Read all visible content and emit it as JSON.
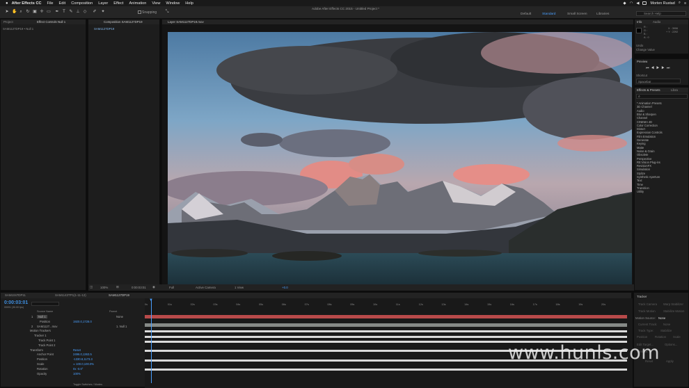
{
  "menubar": {
    "app": "After Effects CC",
    "items": [
      "File",
      "Edit",
      "Composition",
      "Layer",
      "Effect",
      "Animation",
      "View",
      "Window",
      "Help"
    ],
    "user": "Morten Rustad"
  },
  "toolbar": {
    "snapping": "Snapping",
    "window_title": "Adobe After Effects CC 2015 - Untitled Project *",
    "workspaces": [
      "Default",
      "Standard",
      "Small Screen",
      "Libraries"
    ],
    "active_workspace": "Standard",
    "search_placeholder": "Search Help"
  },
  "project_panel": {
    "tabs": [
      "Project",
      "Effect Controls Null 1"
    ],
    "breadcrumb": "SAM1127DP19 • Null 1"
  },
  "comp_panel": {
    "tab": "Composition SAM1127DP19",
    "comp_name": "SAM1127DP19",
    "layer_tab": "Layer SAM1127DP19.mov"
  },
  "viewer_bar": {
    "zoom": "100%",
    "timecode": "0:00:03:01",
    "resolution": "Full",
    "camera": "Active Camera",
    "views": "1 View",
    "offset": "+0.0"
  },
  "info_panel": {
    "tabs": [
      "Info",
      "Audio"
    ],
    "values": [
      "R :",
      "G :",
      "B :",
      "A : 0"
    ],
    "coords": [
      "X : 3996",
      "+ Y : 2292"
    ],
    "undo_label": "Undo",
    "undo_value": "Change Value"
  },
  "preview_panel": {
    "title": "Preview",
    "shortcut_label": "Shortcut",
    "shortcut_value": "Spacebar"
  },
  "effects_panel": {
    "tabs": [
      "Effects & Presets",
      "Libra"
    ],
    "items": [
      "* Animation Presets",
      "3D Channel",
      "Audio",
      "Blur & Sharpen",
      "Channel",
      "CINEMA 4D",
      "Color Correction",
      "Distort",
      "Expression Controls",
      "Film Emulation",
      "Generate",
      "Keying",
      "Matte",
      "Noise & Grain",
      "Obsolete",
      "Perspective",
      "RE:Vision Plug-ins",
      "RevisionFX",
      "Simulation",
      "Stylize",
      "Synthetic Aperture",
      "Text",
      "Time",
      "Transition",
      "Utility"
    ]
  },
  "timeline": {
    "tabs": [
      "SAM1047DP11",
      "SAM1143TP1(1-11-12)",
      "SAM1127DP19"
    ],
    "timecode": "0:00:03:01",
    "frame_info": "00091 (30.00 fps)",
    "source_name_header": "Source Name",
    "parent_header": "Parent",
    "ruler_marks": [
      "0s",
      "01s",
      "02s",
      "03s",
      "04s",
      "05s",
      "06s",
      "07s",
      "08s",
      "09s",
      "10s",
      "11s",
      "12s",
      "13s",
      "14s",
      "15s",
      "16s",
      "17s",
      "18s",
      "19s",
      "20s"
    ],
    "layers": [
      {
        "num": "1",
        "name": "Null 1",
        "parent": "None"
      },
      {
        "num": "",
        "name": "Position",
        "value": "1920.0,1728.0"
      },
      {
        "num": "2",
        "name": "SAM1127...mov",
        "parent": "1. Null 1"
      },
      {
        "num": "",
        "name": "Motion Trackers"
      },
      {
        "num": "",
        "name": "Tracker 1"
      },
      {
        "num": "",
        "name": "Track Point 1"
      },
      {
        "num": "",
        "name": "Track Point 2"
      },
      {
        "num": "",
        "name": "Transform",
        "value": "Reset"
      },
      {
        "num": "",
        "name": "Anchor Point",
        "value": "2496.0,1363.5"
      },
      {
        "num": "",
        "name": "Position",
        "value": "-1330.8,1173.3"
      },
      {
        "num": "",
        "name": "Scale",
        "value": "∞ 100.0,100.0%"
      },
      {
        "num": "",
        "name": "Rotation",
        "value": "0x -0.0°"
      },
      {
        "num": "",
        "name": "Opacity",
        "value": "100%"
      }
    ],
    "footer": "Toggle Switches / Modes"
  },
  "tracker_panel": {
    "title": "Tracker",
    "buttons": [
      "Track Camera",
      "Warp Stabilizer",
      "Track Motion",
      "Stabilize Motion"
    ],
    "motion_source_label": "Motion Source:",
    "motion_source_value": "None",
    "current_track_label": "Current Track:",
    "current_track_value": "None",
    "track_type_label": "Track Type:",
    "track_type_value": "Stabilize",
    "checkboxes": [
      "Position",
      "Rotation",
      "Scale"
    ],
    "edit_target": "Edit Target...",
    "options": "Options...",
    "analyze_label": "Analyze:",
    "reset": "Reset",
    "apply": "Apply"
  },
  "watermark": "www.hunls.com",
  "colors": {
    "accent": "#4aa0ff",
    "timecode": "#3f8fe0",
    "layer_red": "#b84a4a"
  }
}
